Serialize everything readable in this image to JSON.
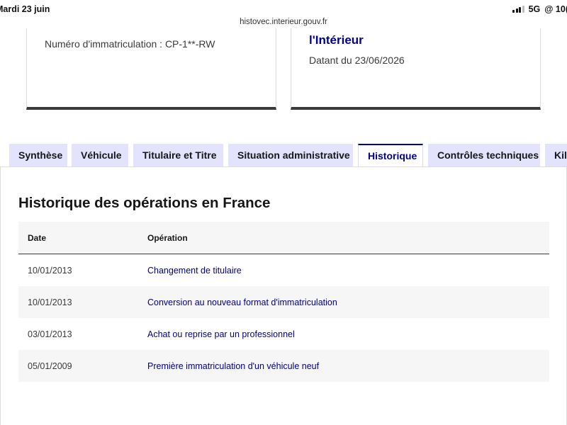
{
  "status_bar": {
    "time": "Mardi 23 juin",
    "network": "5G",
    "battery": "@ 10("
  },
  "browser": {
    "url": "histovec.interieur.gouv.fr"
  },
  "vehicle_card": {
    "plate_text": "Numéro d'immatriculation : CP-1**-RW"
  },
  "report_card": {
    "issuer_text": "l'Intérieur",
    "date_text": "Datant du 23/06/2026"
  },
  "tabs": [
    {
      "label": "Synthèse",
      "active": false
    },
    {
      "label": "Véhicule",
      "active": false
    },
    {
      "label": "Titulaire et Titre",
      "active": false
    },
    {
      "label": "Situation administrative",
      "active": false
    },
    {
      "label": "Historique",
      "active": true
    },
    {
      "label": "Contrôles techniques",
      "active": false
    },
    {
      "label": "Kilo",
      "active": false
    }
  ],
  "history": {
    "title": "Historique des opérations en France",
    "columns": {
      "date": "Date",
      "operation": "Opération"
    },
    "rows": [
      {
        "date": "10/01/2013",
        "operation": "Changement de titulaire"
      },
      {
        "date": "10/01/2013",
        "operation": "Conversion au nouveau format d'immatriculation"
      },
      {
        "date": "03/01/2013",
        "operation": "Achat ou reprise par un professionnel"
      },
      {
        "date": "05/01/2009",
        "operation": "Première immatriculation d'un véhicule neuf"
      }
    ]
  },
  "colors": {
    "primary": "#000091",
    "tab_background": "#e3e3fd",
    "row_alt": "#f6f6f6"
  }
}
